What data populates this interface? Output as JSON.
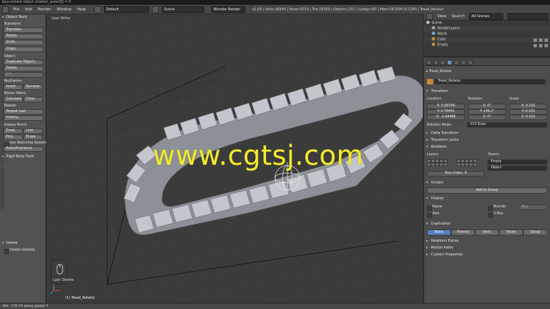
{
  "titlebar": {
    "text": "bpy.context.object.rotation_euler[0] = 0"
  },
  "header": {
    "menus": [
      "File",
      "Add",
      "Render",
      "Window",
      "Help"
    ],
    "layout": "Default",
    "scene": "Scene",
    "engine": "Blender Render",
    "stats": "v2.69 | Verts:28345 | Faces:9153 | Tris:18359 | Objects:1/57 | Lamps:0/0 | Mem:24.55M (0.11M) | Tread_Rotator"
  },
  "toolshelf": {
    "title": "Object Tools",
    "transform_label": "Transform:",
    "translate": "Translate",
    "rotate": "Rotate",
    "scale": "Scale",
    "origin": "Origin",
    "object_label": "Object:",
    "duplicate": "Duplicate Objects",
    "delete": "Delete",
    "join": "Join",
    "keyframes_label": "Keyframes:",
    "insert": "Insert",
    "remove": "Remove",
    "motion_label": "Motion Paths:",
    "calculate": "Calculate",
    "clear": "Clear",
    "repeat_label": "Repeat:",
    "repeat_last": "Repeat Last",
    "history": "History...",
    "grease_label": "Grease Pencil:",
    "draw": "Draw",
    "line": "Line",
    "poly": "Poly",
    "erase": "Erase",
    "sketching": "Use Sketching Sessions",
    "ruler": "Ruler/Protractor",
    "rigid_body": "Rigid Body Tools",
    "delete_panel": "Delete",
    "delete_globally": "Delete Globally"
  },
  "viewport": {
    "label": "User Ortho",
    "selected": "(1) Tread_Rotator",
    "last_op": "Last: Delete",
    "watermark": "www.cgtsj.com"
  },
  "footer": {
    "status": "Rot: 178.74 along global Y"
  },
  "outliner": {
    "view": "View",
    "search": "Search",
    "filter": "All Scenes",
    "rows": [
      "Scene",
      "RenderLayers",
      "World",
      "Cube",
      "Empty"
    ]
  },
  "properties": {
    "object_name": "Tread_Rotator",
    "breadcrumb": "Tread_Rotator",
    "transform": "Transform",
    "location": "Location:",
    "rotation": "Rotation:",
    "scale": "Scale:",
    "loc": [
      "X: 0.00799",
      "Y: 0.76442",
      "Z: -1.04498"
    ],
    "rot": [
      "X: 0°",
      "Y: 149.2°",
      "Z: 0°"
    ],
    "scl": [
      "X: 0.102",
      "Y: 0.102",
      "Z: 0.102"
    ],
    "rotation_mode_label": "Rotation Mode:",
    "rotation_mode": "XYZ Euler",
    "delta_transform": "Delta Transform",
    "transform_locks": "Transform Locks",
    "relations": "Relations",
    "layers": "Layers:",
    "parent": "Parent:",
    "parent_value": "Empty",
    "parent_type": "Object",
    "pass_index": "Pass Index: 0",
    "groups": "Groups",
    "add_to_group": "Add to Group",
    "display": "Display",
    "name": "Name",
    "axis": "Axis",
    "bounds": "Bounds",
    "bounds_type": "Box",
    "xray": "X-Ray",
    "duplication": "Duplication",
    "dup_none": "None",
    "dup_frames": "Frames",
    "dup_verts": "Verts",
    "dup_faces": "Faces",
    "dup_group": "Group",
    "relations_extras": "Relations Extras",
    "motion_paths": "Motion Paths",
    "custom_properties": "Custom Properties"
  },
  "colors": {
    "accent": "#5680c2",
    "watermark": "#f2ea2e",
    "tread": "#b9bcc4"
  }
}
